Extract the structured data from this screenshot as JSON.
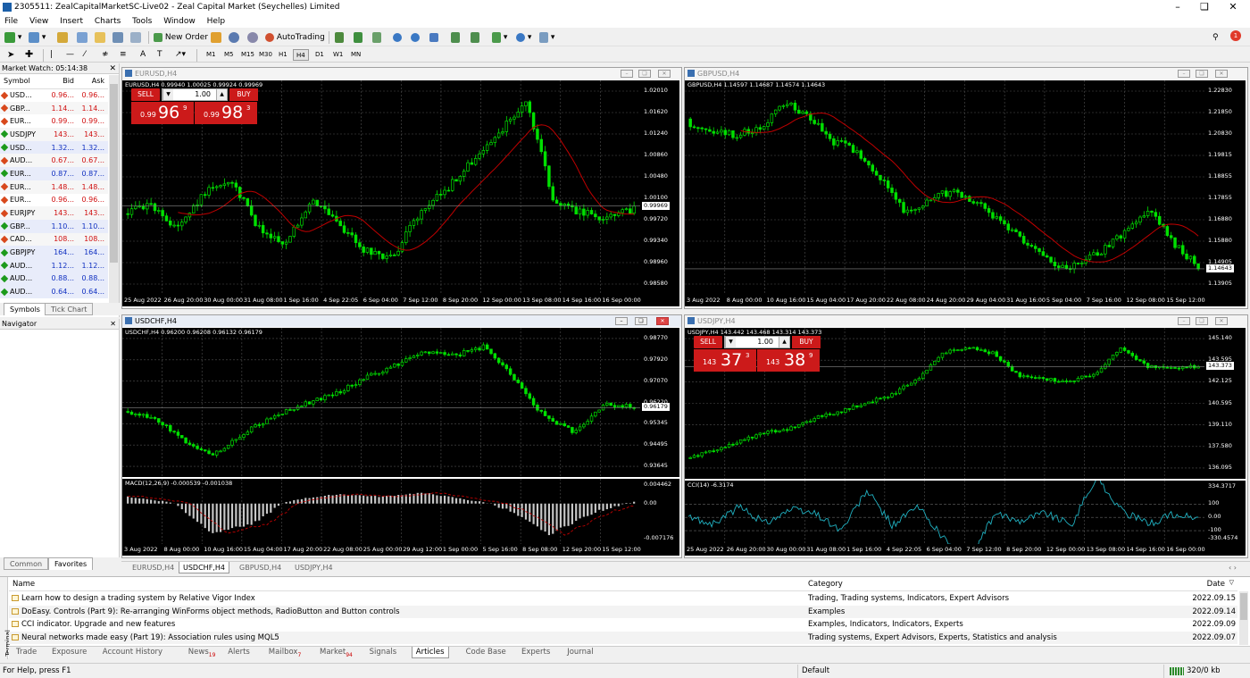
{
  "window": {
    "title": "2305511: ZealCapitalMarketSC-Live02 - Zeal Capital Market (Seychelles) Limited"
  },
  "menu": [
    "File",
    "View",
    "Insert",
    "Charts",
    "Tools",
    "Window",
    "Help"
  ],
  "toolbar": {
    "new_order": "New Order",
    "autotrading": "AutoTrading",
    "notify_count": "1"
  },
  "timeframes": [
    "M1",
    "M5",
    "M15",
    "M30",
    "H1",
    "H4",
    "D1",
    "W1",
    "MN"
  ],
  "active_timeframe": "H4",
  "market_watch": {
    "title": "Market Watch: 05:14:38",
    "columns": [
      "Symbol",
      "Bid",
      "Ask"
    ],
    "rows": [
      {
        "symbol": "USD...",
        "bid": "0.96...",
        "ask": "0.96...",
        "dir": "down",
        "color": "red"
      },
      {
        "symbol": "GBP...",
        "bid": "1.14...",
        "ask": "1.14...",
        "dir": "down",
        "color": "red"
      },
      {
        "symbol": "EUR...",
        "bid": "0.99...",
        "ask": "0.99...",
        "dir": "down",
        "color": "red"
      },
      {
        "symbol": "USDJPY",
        "bid": "143...",
        "ask": "143...",
        "dir": "up",
        "color": "red"
      },
      {
        "symbol": "USD...",
        "bid": "1.32...",
        "ask": "1.32...",
        "dir": "up",
        "color": "blue"
      },
      {
        "symbol": "AUD...",
        "bid": "0.67...",
        "ask": "0.67...",
        "dir": "down",
        "color": "red"
      },
      {
        "symbol": "EUR...",
        "bid": "0.87...",
        "ask": "0.87...",
        "dir": "up",
        "color": "blue"
      },
      {
        "symbol": "EUR...",
        "bid": "1.48...",
        "ask": "1.48...",
        "dir": "down",
        "color": "red"
      },
      {
        "symbol": "EUR...",
        "bid": "0.96...",
        "ask": "0.96...",
        "dir": "down",
        "color": "red"
      },
      {
        "symbol": "EURJPY",
        "bid": "143...",
        "ask": "143...",
        "dir": "down",
        "color": "red"
      },
      {
        "symbol": "GBP...",
        "bid": "1.10...",
        "ask": "1.10...",
        "dir": "up",
        "color": "blue"
      },
      {
        "symbol": "CAD...",
        "bid": "108...",
        "ask": "108...",
        "dir": "down",
        "color": "red"
      },
      {
        "symbol": "GBPJPY",
        "bid": "164...",
        "ask": "164...",
        "dir": "up",
        "color": "blue"
      },
      {
        "symbol": "AUD...",
        "bid": "1.12...",
        "ask": "1.12...",
        "dir": "up",
        "color": "blue"
      },
      {
        "symbol": "AUD...",
        "bid": "0.88...",
        "ask": "0.88...",
        "dir": "up",
        "color": "blue"
      },
      {
        "symbol": "AUD...",
        "bid": "0.64...",
        "ask": "0.64...",
        "dir": "up",
        "color": "blue"
      }
    ],
    "tabs": [
      "Symbols",
      "Tick Chart"
    ]
  },
  "navigator": {
    "title": "Navigator",
    "tabs": [
      "Common",
      "Favorites"
    ]
  },
  "charts": {
    "eurusd": {
      "caption": "EURUSD,H4",
      "info": "EURUSD,H4  0.99940 1.00025 0.99924 0.99969",
      "y_labels": [
        "1.02010",
        "1.01620",
        "1.01240",
        "1.00860",
        "1.00480",
        "1.00100",
        "0.99720",
        "0.99340",
        "0.98960",
        "0.98580"
      ],
      "price_tag": "0.99969",
      "x_labels": [
        "25 Aug 2022",
        "26 Aug 20:00",
        "30 Aug 00:00",
        "31 Aug 08:00",
        "1 Sep 16:00",
        "4 Sep 22:05",
        "6 Sep 04:00",
        "7 Sep 12:00",
        "8 Sep 20:00",
        "12 Sep 00:00",
        "13 Sep 08:00",
        "14 Sep 16:00",
        "16 Sep 00:00"
      ],
      "trade": {
        "sell": "SELL",
        "buy": "BUY",
        "lot": "1.00",
        "sell_small": "0.99",
        "sell_big": "96",
        "sell_sup": "9",
        "buy_small": "0.99",
        "buy_big": "98",
        "buy_sup": "3"
      }
    },
    "gbpusd": {
      "caption": "GBPUSD,H4",
      "info": "GBPUSD,H4  1.14597 1.14687 1.14574 1.14643",
      "y_labels": [
        "1.22830",
        "1.21850",
        "1.20830",
        "1.19815",
        "1.18855",
        "1.17855",
        "1.16880",
        "1.15880",
        "1.14905",
        "1.13905"
      ],
      "price_tag": "1.14643",
      "x_labels": [
        "3 Aug 2022",
        "8 Aug 00:00",
        "10 Aug 16:00",
        "15 Aug 04:00",
        "17 Aug 20:00",
        "22 Aug 08:00",
        "24 Aug 20:00",
        "29 Aug 04:00",
        "31 Aug 16:00",
        "5 Sep 04:00",
        "7 Sep 16:00",
        "12 Sep 08:00",
        "15 Sep 12:00"
      ]
    },
    "usdchf": {
      "caption": "USDCHF,H4",
      "info": "USDCHF,H4  0.96200 0.96208 0.96132 0.96179",
      "y_labels": [
        "0.98770",
        "0.97920",
        "0.97070",
        "0.96220",
        "0.95345",
        "0.94495",
        "0.93645"
      ],
      "price_tag": "0.96179",
      "macd_info": "MACD(12,26,9) -0.000539 -0.001038",
      "macd_labels": [
        "0.004462",
        "0.00",
        "-0.007176"
      ],
      "x_labels": [
        "3 Aug 2022",
        "8 Aug 00:00",
        "10 Aug 16:00",
        "15 Aug 04:00",
        "17 Aug 20:00",
        "22 Aug 08:00",
        "25 Aug 00:00",
        "29 Aug 12:00",
        "1 Sep 00:00",
        "5 Sep 16:00",
        "8 Sep 08:00",
        "12 Sep 20:00",
        "15 Sep 12:00"
      ]
    },
    "usdjpy": {
      "caption": "USDJPY,H4",
      "info": "USDJPY,H4  143.442 143.468 143.314 143.373",
      "y_labels": [
        "145.140",
        "143.595",
        "142.125",
        "140.595",
        "139.110",
        "137.580",
        "136.095"
      ],
      "price_tag": "143.373",
      "cci_info": "CCI(14) -6.3174",
      "cci_labels": [
        "334.3717",
        "100",
        "0.00",
        "-100",
        "-330.4574"
      ],
      "x_labels": [
        "25 Aug 2022",
        "26 Aug 20:00",
        "30 Aug 00:00",
        "31 Aug 08:00",
        "1 Sep 16:00",
        "4 Sep 22:05",
        "6 Sep 04:00",
        "7 Sep 12:00",
        "8 Sep 20:00",
        "12 Sep 00:00",
        "13 Sep 08:00",
        "14 Sep 16:00",
        "16 Sep 00:00"
      ],
      "trade": {
        "sell": "SELL",
        "buy": "BUY",
        "lot": "1.00",
        "sell_small": "143",
        "sell_big": "37",
        "sell_sup": "3",
        "buy_small": "143",
        "buy_big": "38",
        "buy_sup": "9"
      }
    }
  },
  "chart_tabs": [
    "EURUSD,H4",
    "USDCHF,H4",
    "GBPUSD,H4",
    "USDJPY,H4"
  ],
  "active_chart_tab": "USDCHF,H4",
  "terminal": {
    "label": "Terminal",
    "columns": {
      "name": "Name",
      "category": "Category",
      "date": "Date"
    },
    "rows": [
      {
        "name": "Learn how to design a trading system by Relative Vigor Index",
        "category": "Trading, Trading systems, Indicators, Expert Advisors",
        "date": "2022.09.15"
      },
      {
        "name": "DoEasy. Controls (Part 9): Re-arranging WinForms object methods, RadioButton and Button controls",
        "category": "Examples",
        "date": "2022.09.14"
      },
      {
        "name": "CCI indicator. Upgrade and new features",
        "category": "Examples, Indicators, Indicators, Experts",
        "date": "2022.09.09"
      },
      {
        "name": "Neural networks made easy (Part 19): Association rules using MQL5",
        "category": "Trading systems, Expert Advisors, Experts, Statistics and analysis",
        "date": "2022.09.07"
      }
    ],
    "tabs": [
      {
        "label": "Trade",
        "badge": ""
      },
      {
        "label": "Exposure",
        "badge": ""
      },
      {
        "label": "Account History",
        "badge": ""
      },
      {
        "label": "News",
        "badge": "19"
      },
      {
        "label": "Alerts",
        "badge": ""
      },
      {
        "label": "Mailbox",
        "badge": "7"
      },
      {
        "label": "Market",
        "badge": "94"
      },
      {
        "label": "Signals",
        "badge": ""
      },
      {
        "label": "Articles",
        "badge": ""
      },
      {
        "label": "Code Base",
        "badge": ""
      },
      {
        "label": "Experts",
        "badge": ""
      },
      {
        "label": "Journal",
        "badge": ""
      }
    ],
    "active_tab": "Articles"
  },
  "status": {
    "help": "For Help, press F1",
    "profile": "Default",
    "traffic": "320/0 kb"
  },
  "colors": {
    "bull": "#00e000",
    "bear": "#00b000",
    "ma": "#c00000",
    "sell": "#cc1a1a",
    "grid": "#4a4a4a"
  }
}
